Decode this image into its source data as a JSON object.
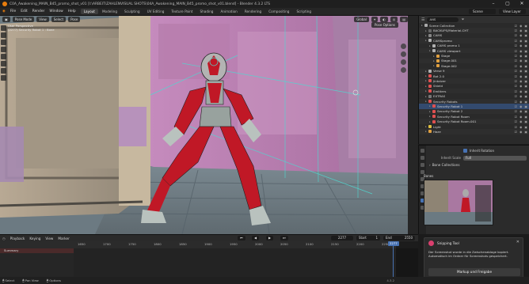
{
  "window": {
    "title": "C0A_Awakening_MAIN_B45_promo_shot_v01 [I:\\ARBEIT\\ZAHLENVISUAL SHOTS\\04A_Awakening_MAIN_B45_promo_shot_v01.blend] - Blender 4.3.2 LTS"
  },
  "menubar": {
    "items": [
      "File",
      "Edit",
      "Render",
      "Window",
      "Help"
    ],
    "workspaces": [
      "Layout",
      "Modeling",
      "Sculpting",
      "UV Editing",
      "Texture Paint",
      "Shading",
      "Animation",
      "Rendering",
      "Compositing",
      "Scripting"
    ],
    "active_workspace": "Layout",
    "scene": "Scene",
    "view_layer": "View Layer",
    "search_value": "ANS"
  },
  "viewport": {
    "mode": "Pose Mode",
    "menus": [
      "View",
      "Select",
      "Pose"
    ],
    "transform": "Global",
    "pose_options": "Pose Options",
    "info_lines": [
      "User Perspective",
      "(2277) Security Robot 1 : Bone"
    ]
  },
  "outliner": {
    "rows": [
      {
        "label": "Scene Collection",
        "indent": 0,
        "color": "#aaaaaa",
        "sel": false
      },
      {
        "label": "BACKUPS/Material-CHT",
        "indent": 1,
        "color": "#666666",
        "sel": false
      },
      {
        "label": "CAMS",
        "indent": 1,
        "color": "#888888",
        "sel": false
      },
      {
        "label": "CAMSpromo",
        "indent": 1,
        "color": "#b0b0b0",
        "sel": false
      },
      {
        "label": "CAMS promo 1",
        "indent": 2,
        "color": "#b0b0b0",
        "sel": false
      },
      {
        "label": "CAMS viewport",
        "indent": 2,
        "color": "#b0b0b0",
        "sel": false
      },
      {
        "label": "Stage",
        "indent": 3,
        "color": "#e0a040",
        "sel": false
      },
      {
        "label": "Stage.001",
        "indent": 3,
        "color": "#e0a040",
        "sel": false
      },
      {
        "label": "Stage.002",
        "indent": 3,
        "color": "#e0a040",
        "sel": false
      },
      {
        "label": "Verse 9",
        "indent": 1,
        "color": "#b0b0b0",
        "sel": false
      },
      {
        "label": "Bot 2.0",
        "indent": 1,
        "color": "#e05050",
        "sel": false
      },
      {
        "label": "Jintaiver",
        "indent": 1,
        "color": "#e05050",
        "sel": false
      },
      {
        "label": "Shield",
        "indent": 1,
        "color": "#e05050",
        "sel": false
      },
      {
        "label": "Emitters",
        "indent": 1,
        "color": "#e05050",
        "sel": false
      },
      {
        "label": "EXTRAS",
        "indent": 1,
        "color": "#777777",
        "sel": false
      },
      {
        "label": "Security Robots",
        "indent": 1,
        "color": "#e05050",
        "sel": false
      },
      {
        "label": "Security Robot 1",
        "indent": 2,
        "color": "#e05050",
        "sel": true
      },
      {
        "label": "Security Robot 2",
        "indent": 2,
        "color": "#e05050",
        "sel": false
      },
      {
        "label": "Security Robot Room",
        "indent": 2,
        "color": "#e05050",
        "sel": false
      },
      {
        "label": "Security Robot Room.001",
        "indent": 2,
        "color": "#e05050",
        "sel": false
      },
      {
        "label": "Light",
        "indent": 1,
        "color": "#e0c040",
        "sel": false
      },
      {
        "label": "Haze",
        "indent": 1,
        "color": "#e0a040",
        "sel": false
      }
    ]
  },
  "properties": {
    "inherit_rotation_label": "Inherit Rotation",
    "inherit_scale_label": "Inherit Scale",
    "inherit_scale_value": "Full",
    "bone_collections_label": "Bone Collections",
    "bones_label": "Bones"
  },
  "notification": {
    "app": "Snipping Tool",
    "message": "Der Screenshot wurde in die Zwischenablage kopiert. Automatisch im Ordner für Screenshots gespeichert.",
    "button": "Markup und Freigabe"
  },
  "timeline": {
    "menus": [
      "Playback",
      "Keying",
      "View",
      "Marker"
    ],
    "current_frame": "2277",
    "start_label": "Start",
    "start_value": "1",
    "end_label": "End",
    "end_value": "2550",
    "ruler": [
      "1650",
      "1700",
      "1750",
      "1800",
      "1850",
      "1900",
      "1950",
      "2000",
      "2050",
      "2100",
      "2150",
      "2200",
      "2250"
    ],
    "summary": "Summary"
  },
  "statusbar": {
    "items": [
      "Select",
      "Pan View",
      "Options"
    ],
    "version": "4.3.2"
  },
  "colors": {
    "accent": "#4772b3",
    "robot": "#c01826",
    "pink_wall": "#c78fbd",
    "floor": "#7d8c93"
  }
}
